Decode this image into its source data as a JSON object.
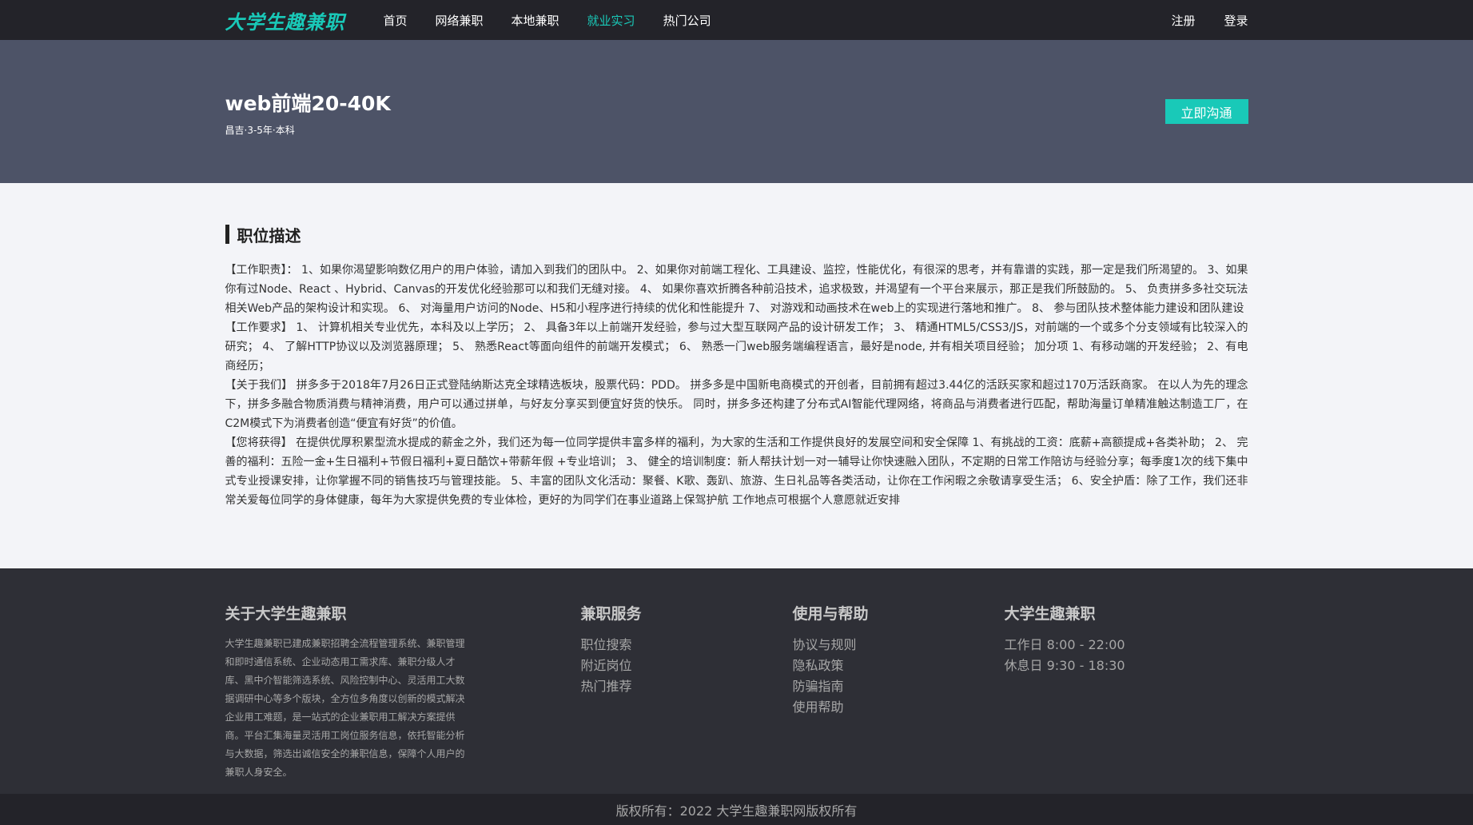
{
  "header": {
    "logo": "大学生趣兼职",
    "nav": [
      {
        "label": "首页",
        "active": false
      },
      {
        "label": "网络兼职",
        "active": false
      },
      {
        "label": "本地兼职",
        "active": false
      },
      {
        "label": "就业实习",
        "active": true
      },
      {
        "label": "热门公司",
        "active": false
      }
    ],
    "register": "注册",
    "login": "登录"
  },
  "job": {
    "title": "web前端20-40K",
    "meta": "昌吉·3-5年·本科",
    "chat_button": "立即沟通"
  },
  "description": {
    "title": "职位描述",
    "paragraphs": [
      "【工作职责】： 1、如果你渴望影响数亿用户的用户体验，请加入到我们的团队中。 2、如果你对前端工程化、工具建设、监控，性能优化，有很深的思考，并有靠谱的实践，那一定是我们所渴望的。 3、如果你有过Node、React 、Hybrid、Canvas的开发优化经验那可以和我们无缝对接。 4、 如果你喜欢折腾各种前沿技术，追求极致，并渴望有一个平台来展示，那正是我们所鼓励的。 5、 负责拼多多社交玩法相关Web产品的架构设计和实现。 6、 对海量用户访问的Node、H5和小程序进行持续的优化和性能提升 7、 对游戏和动画技术在web上的实现进行落地和推广。 8、 参与团队技术整体能力建设和团队建设",
      "【工作要求】 1、 计算机相关专业优先，本科及以上学历； 2、 具备3年以上前端开发经验，参与过大型互联网产品的设计研发工作； 3、 精通HTML5/CSS3/JS，对前端的一个或多个分支领域有比较深入的研究； 4、 了解HTTP协议以及浏览器原理； 5、 熟悉React等面向组件的前端开发模式； 6、 熟悉一门web服务端编程语言，最好是node, 并有相关项目经验； 加分项 1、有移动端的开发经验； 2、有电商经历；",
      "【关于我们】 拼多多于2018年7月26日正式登陆纳斯达克全球精选板块，股票代码：PDD。 拼多多是中国新电商模式的开创者，目前拥有超过3.44亿的活跃买家和超过170万活跃商家。 在以人为先的理念下，拼多多融合物质消费与精神消费，用户可以通过拼单，与好友分享买到便宜好货的快乐。 同时，拼多多还构建了分布式AI智能代理网络，将商品与消费者进行匹配，帮助海量订单精准触达制造工厂，在C2M模式下为消费者创造“便宜有好货”的价值。",
      "【您将获得】 在提供优厚积累型流水提成的薪金之外，我们还为每一位同学提供丰富多样的福利，为大家的生活和工作提供良好的发展空间和安全保障 1、有挑战的工资：底薪+高额提成+各类补助； 2、 完善的福利：五险一金+生日福利+节假日福利+夏日酷饮+带薪年假 +专业培训； 3、 健全的培训制度：新人帮扶计划一对一辅导让你快速融入团队，不定期的日常工作陪访与经验分享；每季度1次的线下集中式专业授课安排，让你掌握不同的销售技巧与管理技能。 5、丰富的团队文化活动：聚餐、K歌、轰趴、旅游、生日礼品等各类活动，让你在工作闲暇之余敬请享受生活； 6、安全护盾：除了工作，我们还非常关爱每位同学的身体健康，每年为大家提供免费的专业体检，更好的为同学们在事业道路上保驾护航 工作地点可根据个人意愿就近安排"
    ]
  },
  "footer": {
    "about_title": "关于大学生趣兼职",
    "about_text": "大学生趣兼职已建成兼职招聘全流程管理系统、兼职管理和即时通信系统、企业动态用工需求库、兼职分级人才库、黑中介智能筛选系统、风险控制中心、灵活用工大数据调研中心等多个版块，全方位多角度以创新的模式解决企业用工难题，是一站式的企业兼职用工解决方案提供商。平台汇集海量灵活用工岗位服务信息，依托智能分析与大数据，筛选出诚信安全的兼职信息，保障个人用户的兼职人身安全。",
    "service_title": "兼职服务",
    "service_links": [
      "职位搜索",
      "附近岗位",
      "热门推荐"
    ],
    "help_title": "使用与帮助",
    "help_links": [
      "协议与规则",
      "隐私政策",
      "防骗指南",
      "使用帮助"
    ],
    "brand_title": "大学生趣兼职",
    "hours": [
      "工作日 8:00 - 22:00",
      "休息日 9:30 - 18:30"
    ],
    "copyright": "版权所有：2022 大学生趣兼职网版权所有"
  }
}
